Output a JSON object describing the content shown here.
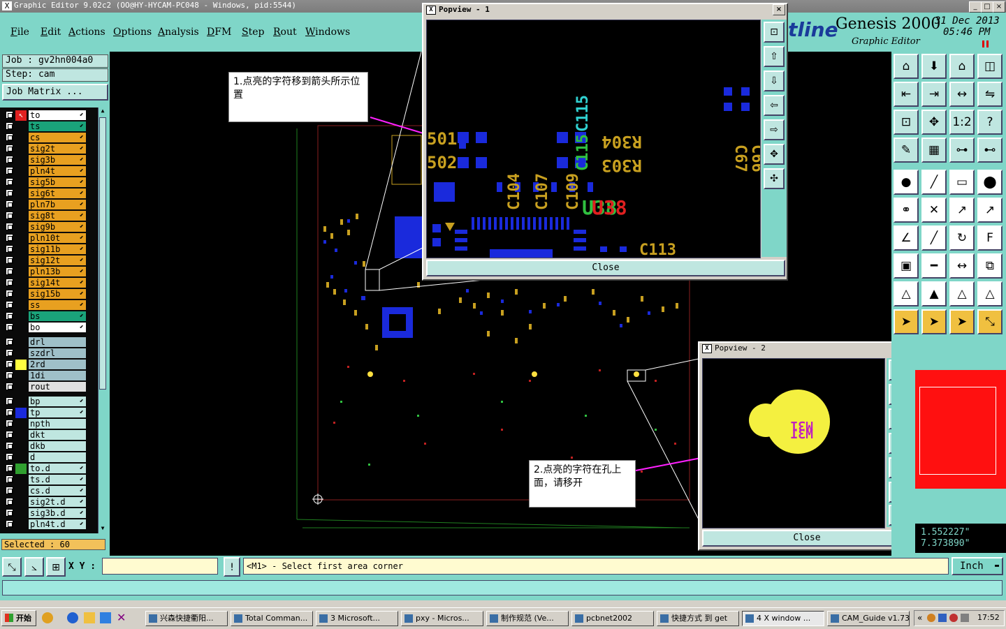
{
  "titlebar": {
    "title": "Graphic Editor 9.02c2 (OO@HY-HYCAM-PC048 - Windows, pid:5544)"
  },
  "menu": {
    "items": [
      "File",
      "Edit",
      "Actions",
      "Options",
      "Analysis",
      "DFM",
      "Step",
      "Rout",
      "Windows"
    ]
  },
  "brand": {
    "logo": "tline",
    "product": "Genesis 2000",
    "subtitle": "Graphic Editor",
    "date": "31 Dec 2013",
    "time": "05:46 PM"
  },
  "job": {
    "job_label": "Job : gv2hn004a0",
    "step_label": "Step: cam",
    "matrix_button": "Job Matrix ..."
  },
  "layers_group1": [
    {
      "name": "to",
      "color": "#ffffff"
    },
    {
      "name": "ts",
      "color": "#1aa37a"
    },
    {
      "name": "cs",
      "color": "#e8a020"
    },
    {
      "name": "sig2t",
      "color": "#e8a020"
    },
    {
      "name": "sig3b",
      "color": "#e8a020"
    },
    {
      "name": "pln4t",
      "color": "#e8a020"
    },
    {
      "name": "sig5b",
      "color": "#e8a020"
    },
    {
      "name": "sig6t",
      "color": "#e8a020"
    },
    {
      "name": "pln7b",
      "color": "#e8a020"
    },
    {
      "name": "sig8t",
      "color": "#e8a020"
    },
    {
      "name": "sig9b",
      "color": "#e8a020"
    },
    {
      "name": "pln10t",
      "color": "#e8a020"
    },
    {
      "name": "sig11b",
      "color": "#e8a020"
    },
    {
      "name": "sig12t",
      "color": "#e8a020"
    },
    {
      "name": "pln13b",
      "color": "#e8a020"
    },
    {
      "name": "sig14t",
      "color": "#e8a020"
    },
    {
      "name": "sig15b",
      "color": "#e8a020"
    },
    {
      "name": "ss",
      "color": "#e8a020"
    },
    {
      "name": "bs",
      "color": "#1aa37a"
    },
    {
      "name": "bo",
      "color": "#ffffff"
    }
  ],
  "layers_group2": [
    {
      "name": "drl",
      "color": "#9fc0c8"
    },
    {
      "name": "szdrl",
      "color": "#9fc0c8"
    },
    {
      "name": "2rd",
      "color": "#9fc0c8"
    },
    {
      "name": "1di",
      "color": "#9fc0c8"
    },
    {
      "name": "rout",
      "color": "#e0e0e0"
    }
  ],
  "layers_group3": [
    {
      "name": "bp",
      "color": "#bfe6e0"
    },
    {
      "name": "tp",
      "color": "#bfe6e0"
    },
    {
      "name": "npth",
      "color": "#bfe6e0"
    },
    {
      "name": "dkt",
      "color": "#bfe6e0"
    },
    {
      "name": "dkb",
      "color": "#bfe6e0"
    },
    {
      "name": "d",
      "color": "#bfe6e0"
    },
    {
      "name": "to.d",
      "color": "#bfe6e0"
    },
    {
      "name": "ts.d",
      "color": "#bfe6e0"
    },
    {
      "name": "cs.d",
      "color": "#bfe6e0"
    },
    {
      "name": "sig2t.d",
      "color": "#bfe6e0"
    },
    {
      "name": "sig3b.d",
      "color": "#bfe6e0"
    },
    {
      "name": "pln4t.d",
      "color": "#bfe6e0"
    }
  ],
  "selected": "Selected : 60",
  "popview1": {
    "title": "Popview - 1",
    "close": "Close",
    "labels": [
      "C115",
      "C115",
      "R304",
      "R303",
      "C104",
      "C107",
      "C109",
      "C113",
      "C67",
      "C66",
      "U38",
      "501",
      "502"
    ]
  },
  "popview2": {
    "title": "Popview - 2",
    "close": "Close",
    "labels": [
      "M31",
      "M31"
    ]
  },
  "annotations": {
    "a1": "1.点亮的字符移到箭头所示位置",
    "a2": "2.点亮的字符在孔上面，请移开"
  },
  "coords": {
    "x": "1.552227\"",
    "y": "7.373890\""
  },
  "status": {
    "xy_label": "X Y :",
    "xy_value": "",
    "prompt": "<M1> - Select first area corner",
    "unit": "Inch"
  },
  "taskbar": {
    "start": "开始",
    "tasks": [
      "兴森快捷衢阳...",
      "Total Comman...",
      "3 Microsoft...",
      "pxy - Micros...",
      "制作规范 (Ve...",
      "pcbnet2002",
      "快捷方式 到 get",
      "4 X window ...",
      "CAM_Guide v1.73"
    ],
    "clock": "17:52"
  }
}
